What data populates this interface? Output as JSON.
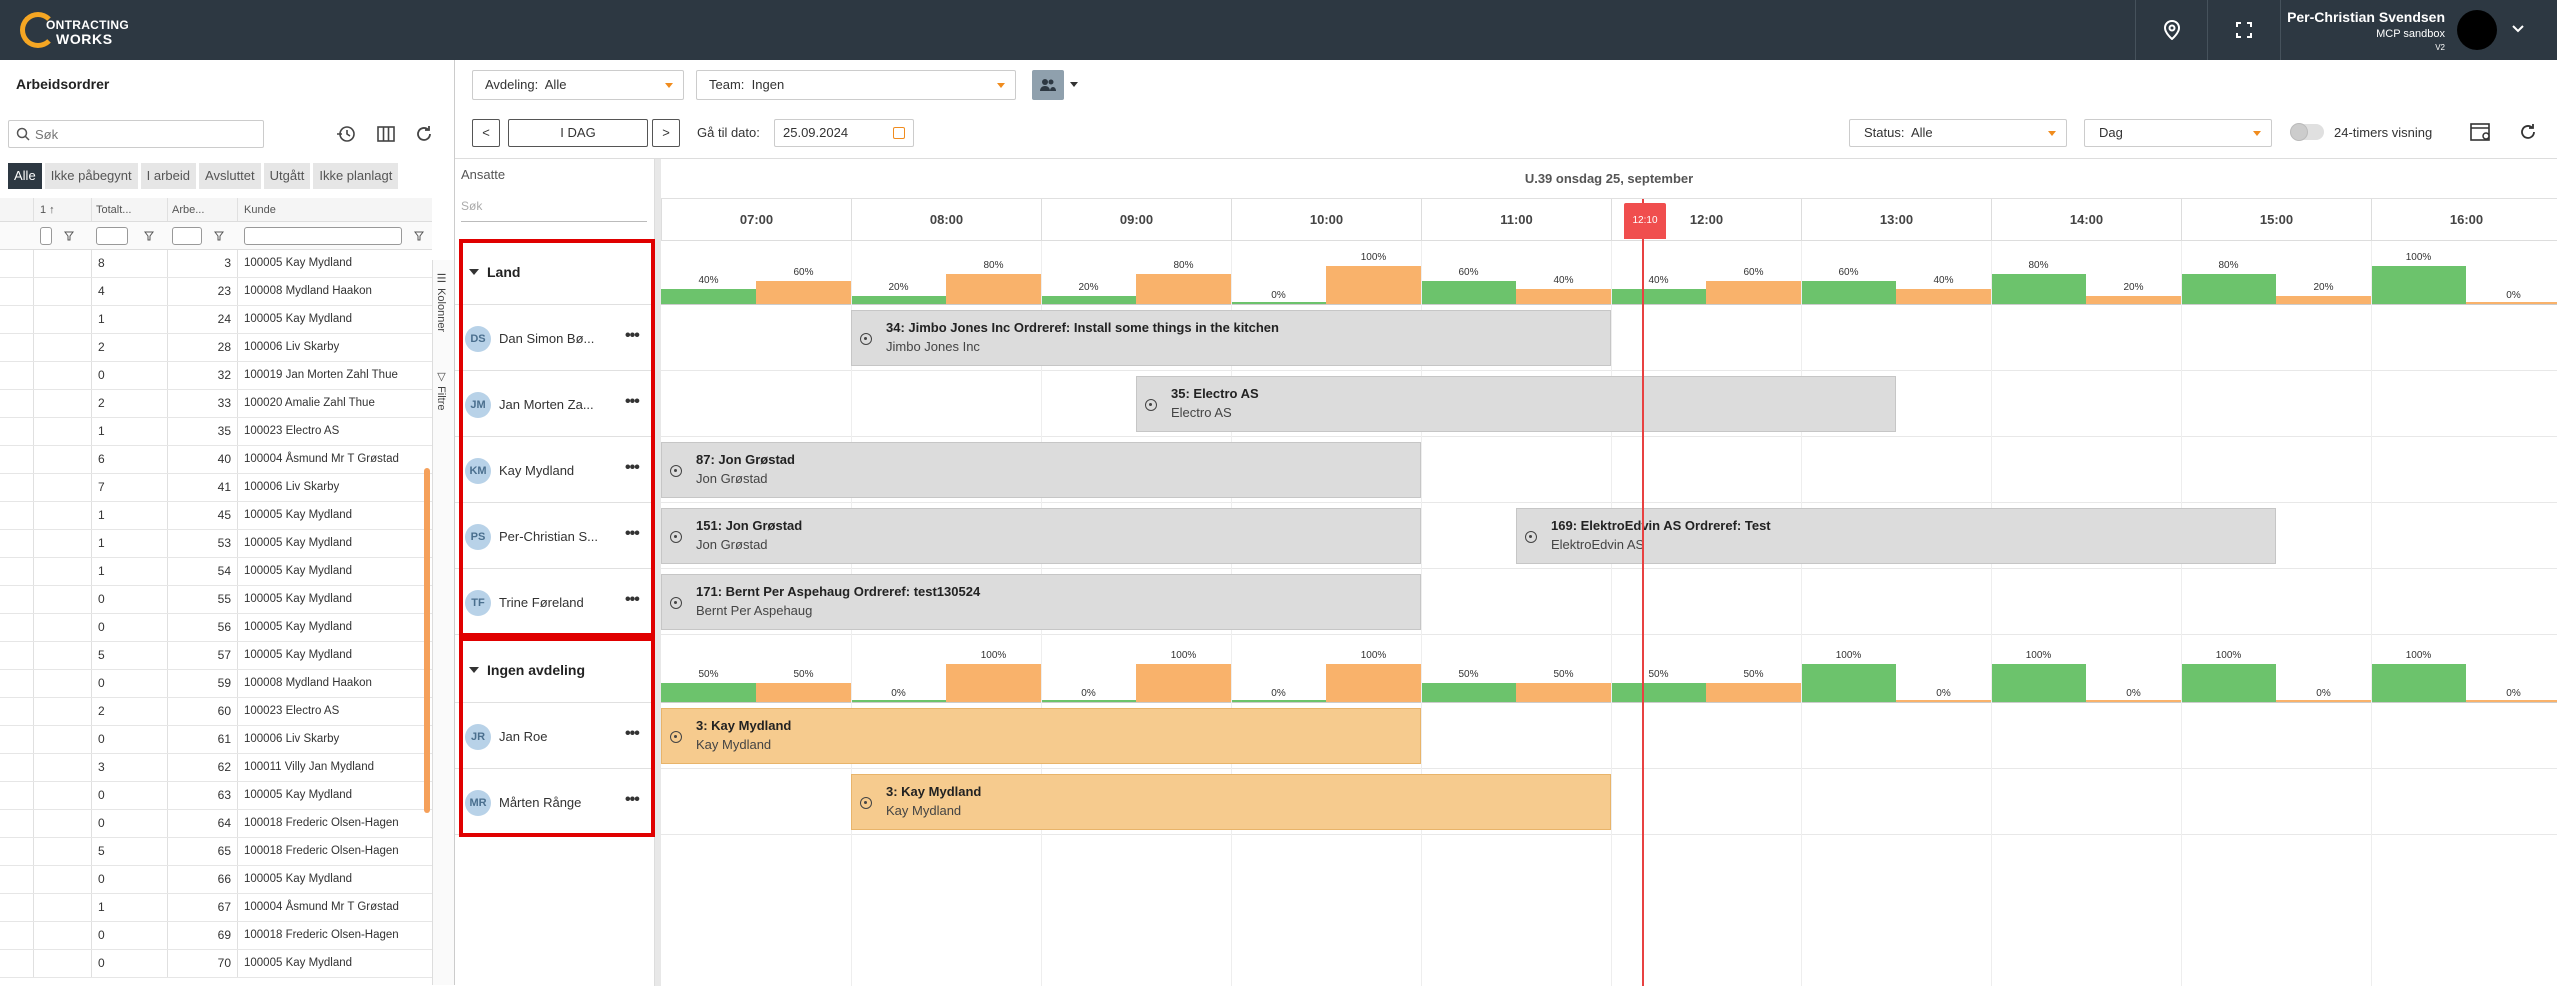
{
  "app": {
    "logo_line1": "ONTRACTING",
    "logo_line2": "WORKS",
    "user_name": "Per-Christian Svendsen",
    "user_sub": "MCP sandbox",
    "user_version": "V2"
  },
  "left": {
    "title": "Arbeidsordrer",
    "search_placeholder": "Søk",
    "tabs": [
      "Alle",
      "Ikke påbegynt",
      "I arbeid",
      "Avsluttet",
      "Utgått",
      "Ikke planlagt"
    ],
    "headers": [
      "1 ↑",
      "Totalt...",
      "Arbe...",
      "Kunde"
    ],
    "side_tabs": [
      "Kolonner",
      "Filtre"
    ],
    "rows": [
      [
        "8",
        "3",
        "100005 Kay Mydland"
      ],
      [
        "4",
        "23",
        "100008 Mydland Haakon"
      ],
      [
        "1",
        "24",
        "100005 Kay Mydland"
      ],
      [
        "2",
        "28",
        "100006 Liv Skarby"
      ],
      [
        "0",
        "32",
        "100019 Jan Morten Zahl Thue"
      ],
      [
        "2",
        "33",
        "100020 Amalie Zahl Thue"
      ],
      [
        "1",
        "35",
        "100023 Electro AS"
      ],
      [
        "6",
        "40",
        "100004 Åsmund Mr T Grøstad"
      ],
      [
        "7",
        "41",
        "100006 Liv Skarby"
      ],
      [
        "1",
        "45",
        "100005 Kay Mydland"
      ],
      [
        "1",
        "53",
        "100005 Kay Mydland"
      ],
      [
        "1",
        "54",
        "100005 Kay Mydland"
      ],
      [
        "0",
        "55",
        "100005 Kay Mydland"
      ],
      [
        "0",
        "56",
        "100005 Kay Mydland"
      ],
      [
        "5",
        "57",
        "100005 Kay Mydland"
      ],
      [
        "0",
        "59",
        "100008 Mydland Haakon"
      ],
      [
        "2",
        "60",
        "100023 Electro AS"
      ],
      [
        "0",
        "61",
        "100006 Liv Skarby"
      ],
      [
        "3",
        "62",
        "100011 Villy Jan Mydland"
      ],
      [
        "0",
        "63",
        "100005 Kay Mydland"
      ],
      [
        "0",
        "64",
        "100018 Frederic Olsen-Hagen"
      ],
      [
        "5",
        "65",
        "100018 Frederic Olsen-Hagen"
      ],
      [
        "0",
        "66",
        "100005 Kay Mydland"
      ],
      [
        "1",
        "67",
        "100004 Åsmund Mr T Grøstad"
      ],
      [
        "0",
        "69",
        "100018 Frederic Olsen-Hagen"
      ],
      [
        "0",
        "70",
        "100005 Kay Mydland"
      ]
    ]
  },
  "toolbar": {
    "avdeling_label": "Avdeling:",
    "avdeling_value": "Alle",
    "team_label": "Team:",
    "team_value": "Ingen",
    "today": "I DAG",
    "prev": "<",
    "next": ">",
    "goto_label": "Gå til dato:",
    "goto_value": "25.09.2024",
    "status_label": "Status:",
    "status_value": "Alle",
    "view_value": "Dag",
    "toggle_label": "24-timers visning"
  },
  "scheduler": {
    "ansatte": "Ansatte",
    "search": "Søk",
    "date_header": "U.39 onsdag 25, september",
    "hours": [
      "07:00",
      "08:00",
      "09:00",
      "10:00",
      "11:00",
      "12:00",
      "13:00",
      "14:00",
      "15:00",
      "16:00"
    ],
    "now_label": "12:10",
    "groups": [
      {
        "name": "Land",
        "load": [
          40,
          60,
          20,
          80,
          20,
          80,
          0,
          100,
          60,
          40,
          40,
          60,
          60,
          40,
          80,
          20,
          80,
          20,
          100,
          0
        ],
        "resources": [
          {
            "initials": "DS",
            "name": "Dan Simon Bø..."
          },
          {
            "initials": "JM",
            "name": "Jan Morten Za..."
          },
          {
            "initials": "KM",
            "name": "Kay Mydland"
          },
          {
            "initials": "PS",
            "name": "Per-Christian S..."
          },
          {
            "initials": "TF",
            "name": "Trine Føreland"
          }
        ]
      },
      {
        "name": "Ingen avdeling",
        "load": [
          50,
          50,
          0,
          100,
          0,
          100,
          0,
          100,
          50,
          50,
          50,
          50,
          100,
          0,
          100,
          0,
          100,
          0,
          100,
          0
        ],
        "resources": [
          {
            "initials": "JR",
            "name": "Jan Roe"
          },
          {
            "initials": "MR",
            "name": "Mårten Rånge"
          }
        ]
      }
    ],
    "tasks": [
      {
        "title": "34: Jimbo Jones Inc Ordreref: Install some things in the kitchen",
        "sub": "Jimbo Jones Inc",
        "row": 0,
        "start": 8.0,
        "end": 12.0,
        "color": "grey"
      },
      {
        "title": "35: Electro AS",
        "sub": "Electro AS",
        "row": 1,
        "start": 9.5,
        "end": 13.5,
        "color": "grey"
      },
      {
        "title": "87: Jon Grøstad",
        "sub": "Jon Grøstad",
        "row": 2,
        "start": 7.0,
        "end": 11.0,
        "color": "grey"
      },
      {
        "title": "151: Jon Grøstad",
        "sub": "Jon Grøstad",
        "row": 3,
        "start": 7.0,
        "end": 11.0,
        "color": "grey"
      },
      {
        "title": "169: ElektroEdvin AS Ordreref: Test",
        "sub": "ElektroEdvin AS",
        "row": 3,
        "start": 11.5,
        "end": 15.5,
        "color": "grey"
      },
      {
        "title": "171: Bernt Per Aspehaug Ordreref: test130524",
        "sub": "Bernt Per Aspehaug",
        "row": 4,
        "start": 7.0,
        "end": 11.0,
        "color": "grey"
      },
      {
        "title": "3: Kay Mydland",
        "sub": "Kay Mydland",
        "row": 5,
        "start": 7.0,
        "end": 11.0,
        "color": "orange"
      },
      {
        "title": "3: Kay Mydland",
        "sub": "Kay Mydland",
        "row": 6,
        "start": 8.0,
        "end": 12.0,
        "color": "orange"
      }
    ],
    "colors": {
      "high": "#6cc36c",
      "low": "#f9b26b",
      "now": "#f04e4e"
    }
  }
}
